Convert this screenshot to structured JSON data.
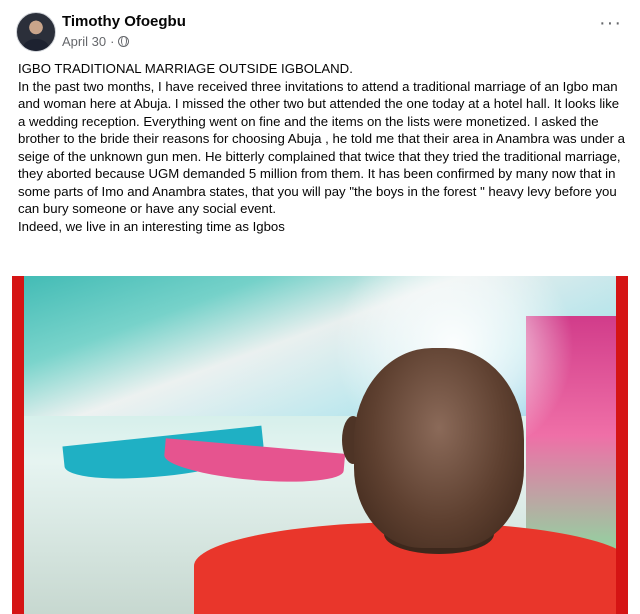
{
  "post": {
    "author": "Timothy Ofoegbu",
    "date": "April 30",
    "separator": "·",
    "more_label": "···",
    "paragraphs": [
      "IGBO TRADITIONAL MARRIAGE OUTSIDE IGBOLAND.",
      "In the past two months, I have received three invitations to attend a traditional marriage of an Igbo man and woman here at Abuja. I missed the other two but attended the one today at a hotel hall. It looks like a wedding reception. Everything went on fine and the items on the lists were monetized. I asked the brother to the bride their reasons for choosing Abuja , he told me that their area in Anambra was under a seige of  the unknown gun men. He bitterly complained  that twice that they tried the traditional marriage, they aborted because UGM demanded 5 million from them. It has been confirmed by many now that in some parts of Imo and Anambra states, that you will pay \"the boys in the forest \" heavy levy before you can bury someone or have any social event.",
      "Indeed, we live in an interesting time as Igbos"
    ]
  },
  "icons": {
    "privacy": "globe-icon",
    "menu": "more-horizontal-icon"
  },
  "colors": {
    "name_text": "#050505",
    "meta_text": "#65676b",
    "photo_border": "#d51414",
    "shirt": "#e9362b"
  }
}
